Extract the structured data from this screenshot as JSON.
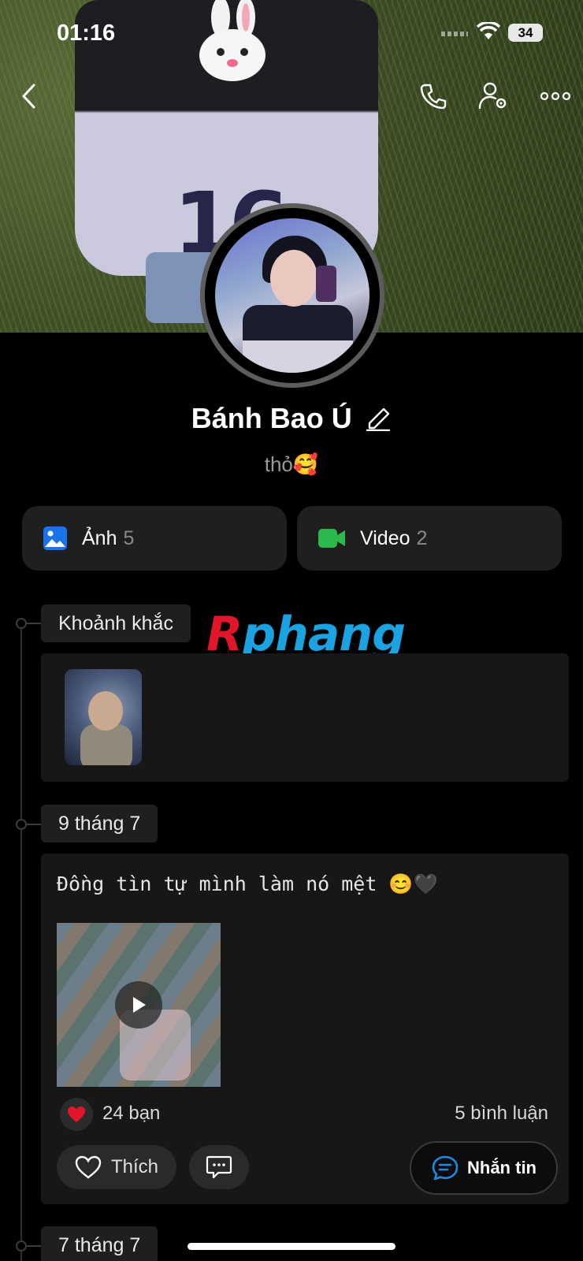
{
  "status_bar": {
    "time": "01:16",
    "battery": "34"
  },
  "profile": {
    "name": "Bánh Bao Ú",
    "bio": "thỏ🥰"
  },
  "media": [
    {
      "label": "Ảnh",
      "count": "5",
      "icon": "photo-icon",
      "color": "#1a73e8"
    },
    {
      "label": "Video",
      "count": "2",
      "icon": "video-camera-icon",
      "color": "#2db84d"
    }
  ],
  "timeline": {
    "moments_label": "Khoảnh khắc",
    "watermark_r": "R",
    "watermark_rest": "phang",
    "date1": "9 tháng 7",
    "post": {
      "text": "Đồng tìn tự mình làm nó mệt 😊🖤",
      "reactions": "24 bạn",
      "comments": "5 bình luận",
      "like_label": "Thích"
    },
    "date2": "7 tháng 7"
  },
  "message_button": "Nhắn tin",
  "colors": {
    "accent": "#1e88e5",
    "heart": "#e0162b"
  }
}
